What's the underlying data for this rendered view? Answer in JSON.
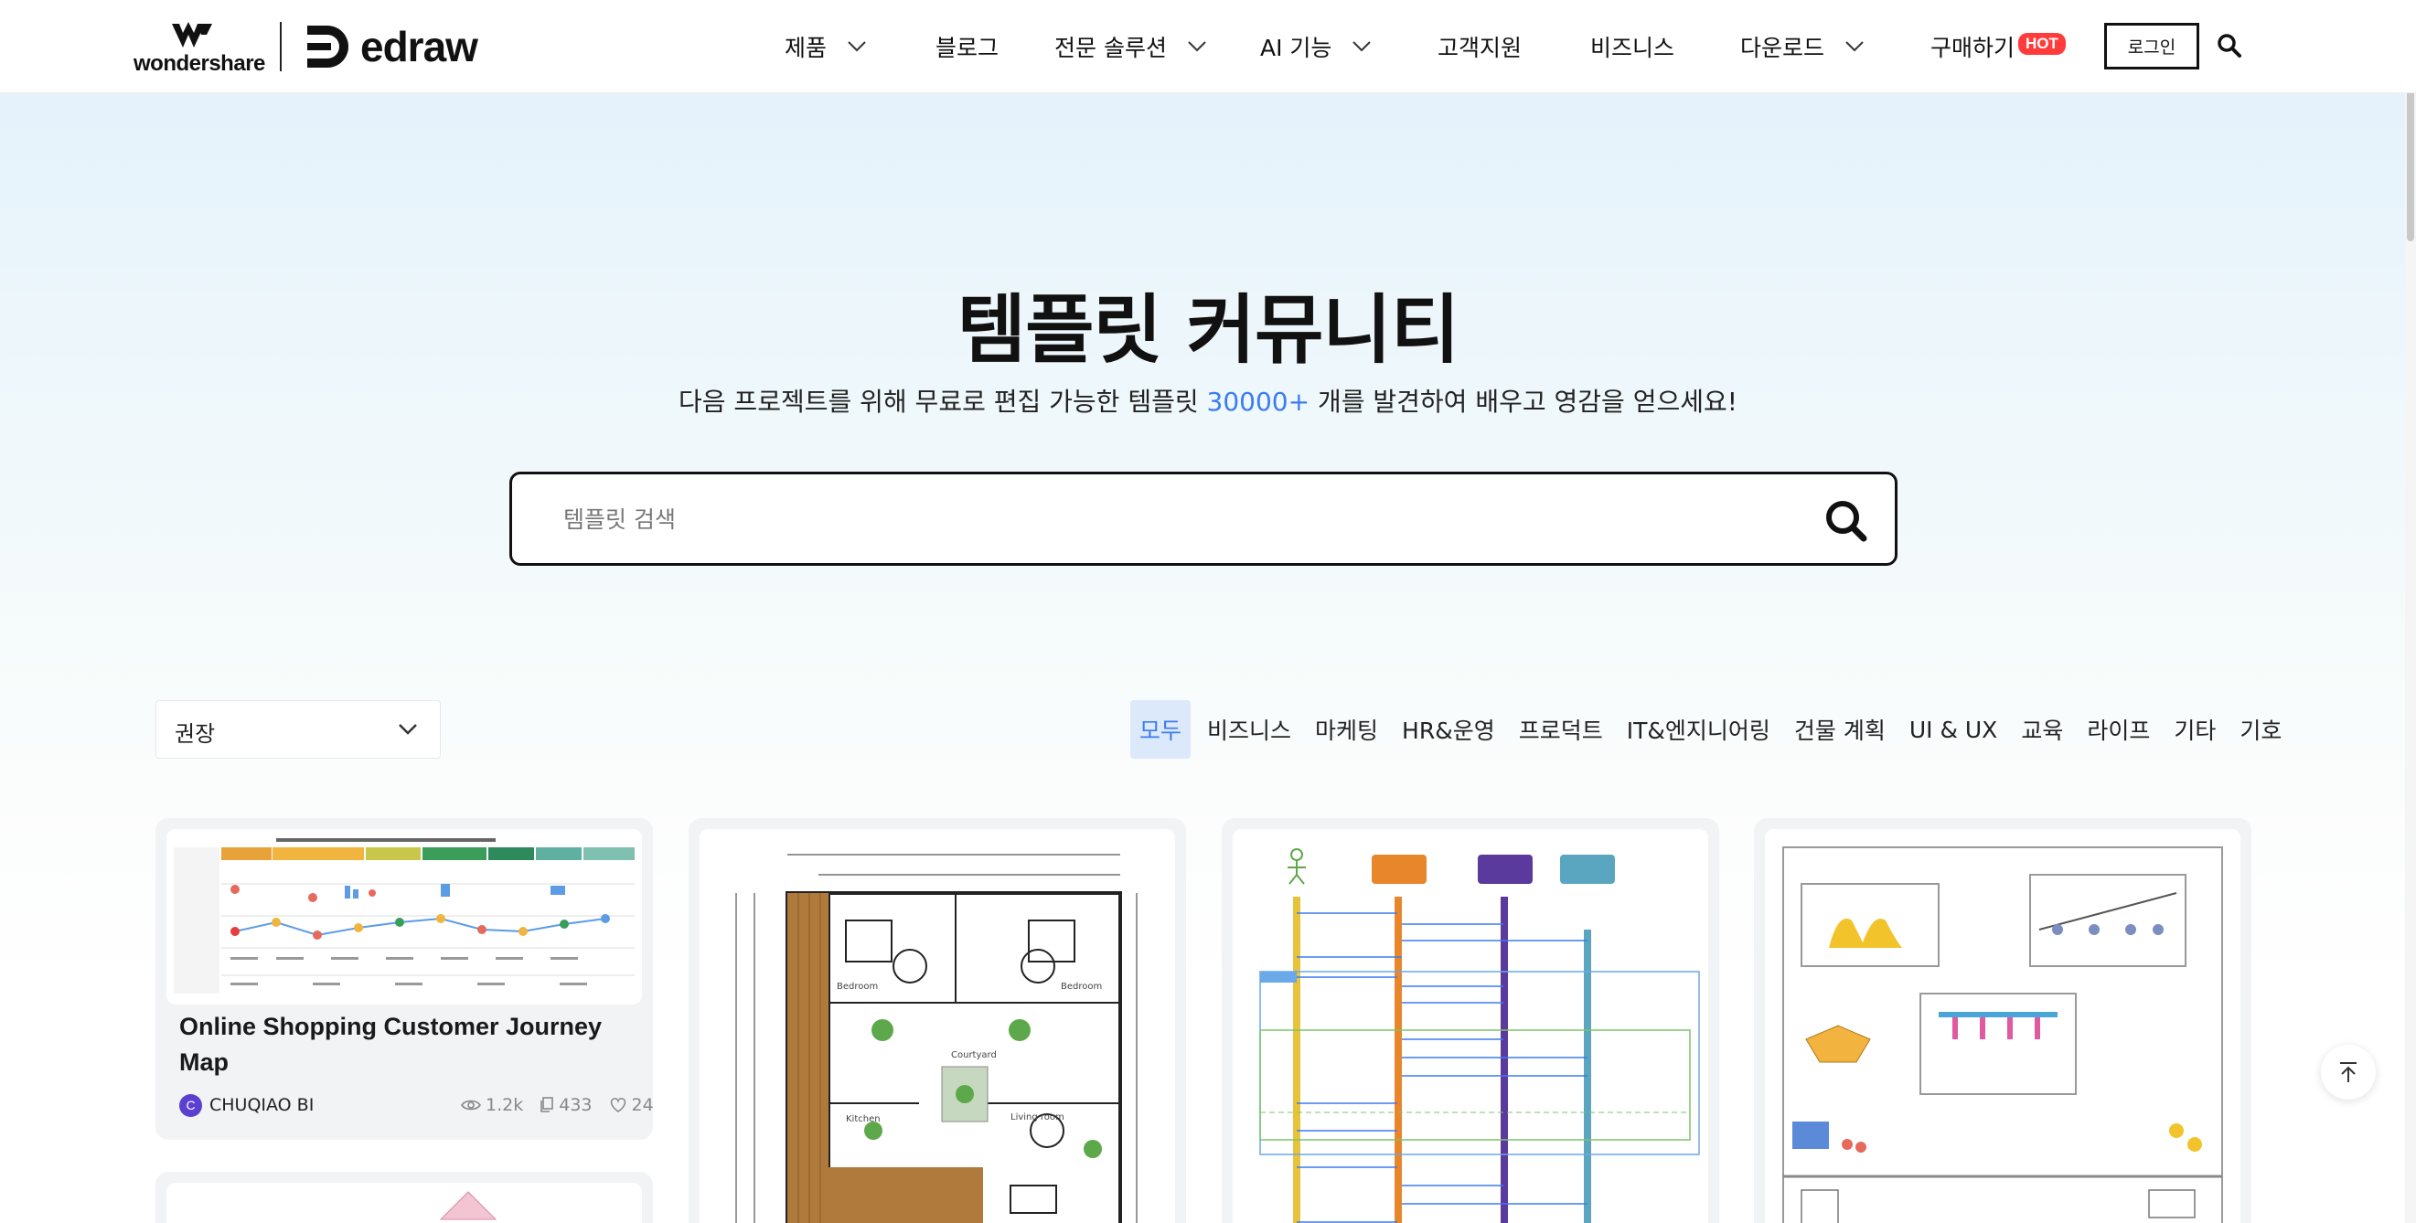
{
  "header": {
    "logo_wondershare": "wondershare",
    "logo_edraw": "edraw",
    "nav": [
      {
        "label": "제품",
        "dropdown": true
      },
      {
        "label": "블로그",
        "dropdown": false
      },
      {
        "label": "전문 솔루션",
        "dropdown": true
      },
      {
        "label": "AI 기능",
        "dropdown": true
      },
      {
        "label": "고객지원",
        "dropdown": false
      },
      {
        "label": "비즈니스",
        "dropdown": false
      },
      {
        "label": "다운로드",
        "dropdown": true
      },
      {
        "label": "구매하기",
        "dropdown": false
      }
    ],
    "hot_badge": "HOT",
    "login_label": "로그인",
    "search_icon": "search-icon"
  },
  "hero": {
    "title": "템플릿 커뮤니티",
    "subtitle_before": "다음 프로젝트를 위해 무료로 편집 가능한 템플릿 ",
    "subtitle_count": "30000+",
    "subtitle_after": " 개를 발견하여 배우고 영감을 얻으세요!",
    "search_placeholder": "템플릿 검색"
  },
  "filters": {
    "sort_value": "권장",
    "categories": [
      "모두",
      "비즈니스",
      "마케팅",
      "HR&운영",
      "프로덕트",
      "IT&엔지니어링",
      "건물 계획",
      "UI & UX",
      "교육",
      "라이프",
      "기타",
      "기호"
    ],
    "active_category": "모두"
  },
  "cards": [
    {
      "title": "Online Shopping Customer Journey Map",
      "author": "CHUQIAO BI",
      "avatar_letter": "C",
      "views": "1.2k",
      "copies": "433",
      "likes": "24"
    }
  ],
  "colors": {
    "accent": "#3b7cf2",
    "hot": "#ff3b3b",
    "active_tab_bg": "#dce9fb",
    "avatar": "#5b3fd1"
  }
}
